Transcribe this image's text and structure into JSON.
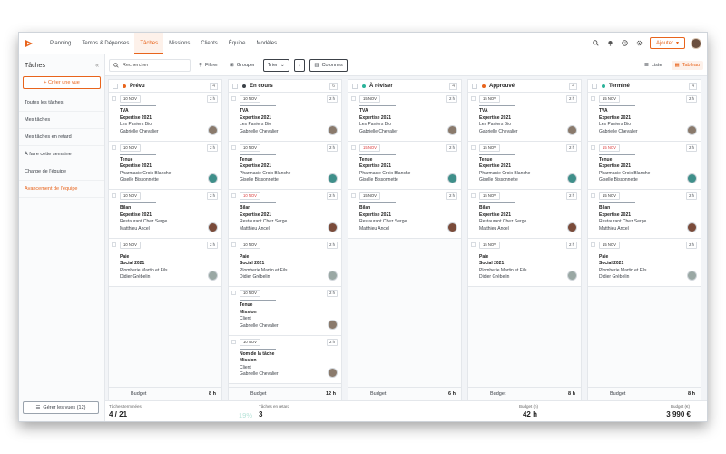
{
  "nav": {
    "items": [
      "Planning",
      "Temps & Dépenses",
      "Tâches",
      "Missions",
      "Clients",
      "Équipe",
      "Modèles"
    ],
    "active_index": 2,
    "add_label": "Ajouter"
  },
  "sidebar": {
    "title": "Tâches",
    "create_label": "+ Créer une vue",
    "items": [
      "Toutes les tâches",
      "Mes tâches",
      "Mes tâches en retard",
      "À faire cette semaine",
      "Charge de l'équipe",
      "Avancement de l'équipe"
    ],
    "active_index": 5,
    "manage_label": "Gérer les vues (12)"
  },
  "toolbar": {
    "search_placeholder": "Rechercher",
    "filter_label": "Filtrer",
    "group_label": "Grouper",
    "sort_label": "Trier",
    "columns_label": "Colonnes",
    "list_label": "Liste",
    "board_label": "Tableau"
  },
  "colors": {
    "accent": "#e8641c",
    "planned": "#e8641c",
    "in_progress": "#3c4148",
    "review": "#2bb39a",
    "approved": "#e8641c",
    "done": "#2bb39a"
  },
  "columns": [
    {
      "title": "Prévu",
      "dot": "#e8641c",
      "count": "4",
      "cards": [
        {
          "date": "10 NOV",
          "late": false,
          "hours": "2 h",
          "t1": "TVA",
          "t2": "Expertise 2021",
          "client": "Les Paniers Bio",
          "person": "Gabrielle Chevalier",
          "av": "#8a7a6c"
        },
        {
          "date": "10 NOV",
          "late": false,
          "hours": "2 h",
          "t1": "Tenue",
          "t2": "Expertise 2021",
          "client": "Pharmacie Croix Blanche",
          "person": "Giselle Bissonnette",
          "av": "#3f8f8a"
        },
        {
          "date": "10 NOV",
          "late": false,
          "hours": "2 h",
          "t1": "Bilan",
          "t2": "Expertise 2021",
          "client": "Restaurant Chez Serge",
          "person": "Matthieu Ancel",
          "av": "#7a4b3a"
        },
        {
          "date": "10 NOV",
          "late": false,
          "hours": "2 h",
          "t1": "Paie",
          "t2": "Social 2021",
          "client": "Plomberie Martin et Fils",
          "person": "Didier Grébelin",
          "av": "#9aa8a4"
        }
      ],
      "budget_label": "Budget",
      "budget": "8 h"
    },
    {
      "title": "En cours",
      "dot": "#3c4148",
      "count": "6",
      "cards": [
        {
          "date": "10 NOV",
          "late": false,
          "hours": "2 h",
          "t1": "TVA",
          "t2": "Expertise 2021",
          "client": "Les Paniers Bio",
          "person": "Gabrielle Chevalier",
          "av": "#8a7a6c"
        },
        {
          "date": "10 NOV",
          "late": false,
          "hours": "2 h",
          "t1": "Tenue",
          "t2": "Expertise 2021",
          "client": "Pharmacie Croix Blanche",
          "person": "Giselle Bissonnette",
          "av": "#3f8f8a"
        },
        {
          "date": "10 NOV",
          "late": true,
          "hours": "2 h",
          "t1": "Bilan",
          "t2": "Expertise 2021",
          "client": "Restaurant Chez Serge",
          "person": "Matthieu Ancel",
          "av": "#7a4b3a"
        },
        {
          "date": "10 NOV",
          "late": false,
          "hours": "2 h",
          "t1": "Paie",
          "t2": "Social 2021",
          "client": "Plomberie Martin et Fils",
          "person": "Didier Grébelin",
          "av": "#9aa8a4"
        },
        {
          "date": "10 NOV",
          "late": false,
          "hours": "2 h",
          "t1": "Tenue",
          "t2": "Mission",
          "client": "Client",
          "person": "Gabrielle Chevalier",
          "av": "#8a7a6c"
        },
        {
          "date": "10 NOV",
          "late": false,
          "hours": "2 h",
          "t1": "Nom de la tâche",
          "t2": "Mission",
          "client": "Client",
          "person": "Gabrielle Chevalier",
          "av": "#8a7a6c"
        }
      ],
      "budget_label": "Budget",
      "budget": "12 h"
    },
    {
      "title": "À réviser",
      "dot": "#2bb39a",
      "count": "4",
      "cards": [
        {
          "date": "15 NOV",
          "late": false,
          "hours": "2 h",
          "t1": "TVA",
          "t2": "Expertise 2021",
          "client": "Les Paniers Bio",
          "person": "Gabrielle Chevalier",
          "av": "#8a7a6c"
        },
        {
          "date": "15 NOV",
          "late": true,
          "hours": "2 h",
          "t1": "Tenue",
          "t2": "Expertise 2021",
          "client": "Pharmacie Croix Blanche",
          "person": "Giselle Bissonnette",
          "av": "#3f8f8a"
        },
        {
          "date": "15 NOV",
          "late": false,
          "hours": "2 h",
          "t1": "Bilan",
          "t2": "Expertise 2021",
          "client": "Restaurant Chez Serge",
          "person": "Matthieu Ancel",
          "av": "#7a4b3a"
        }
      ],
      "budget_label": "Budget",
      "budget": "6 h"
    },
    {
      "title": "Approuvé",
      "dot": "#e8641c",
      "count": "4",
      "cards": [
        {
          "date": "15 NOV",
          "late": false,
          "hours": "2 h",
          "t1": "TVA",
          "t2": "Expertise 2021",
          "client": "Les Paniers Bio",
          "person": "Gabrielle Chevalier",
          "av": "#8a7a6c"
        },
        {
          "date": "15 NOV",
          "late": false,
          "hours": "2 h",
          "t1": "Tenue",
          "t2": "Expertise 2021",
          "client": "Pharmacie Croix Blanche",
          "person": "Giselle Bissonnette",
          "av": "#3f8f8a"
        },
        {
          "date": "15 NOV",
          "late": false,
          "hours": "2 h",
          "t1": "Bilan",
          "t2": "Expertise 2021",
          "client": "Restaurant Chez Serge",
          "person": "Matthieu Ancel",
          "av": "#7a4b3a"
        },
        {
          "date": "15 NOV",
          "late": false,
          "hours": "2 h",
          "t1": "Paie",
          "t2": "Social 2021",
          "client": "Plomberie Martin et Fils",
          "person": "Didier Grébelin",
          "av": "#9aa8a4"
        }
      ],
      "budget_label": "Budget",
      "budget": "8 h"
    },
    {
      "title": "Terminé",
      "dot": "#2bb39a",
      "count": "4",
      "cards": [
        {
          "date": "15 NOV",
          "late": false,
          "hours": "2 h",
          "t1": "TVA",
          "t2": "Expertise 2021",
          "client": "Les Paniers Bio",
          "person": "Gabrielle Chevalier",
          "av": "#8a7a6c"
        },
        {
          "date": "15 NOV",
          "late": true,
          "hours": "2 h",
          "t1": "Tenue",
          "t2": "Expertise 2021",
          "client": "Pharmacie Croix Blanche",
          "person": "Giselle Bissonnette",
          "av": "#3f8f8a"
        },
        {
          "date": "15 NOV",
          "late": false,
          "hours": "2 h",
          "t1": "Bilan",
          "t2": "Expertise 2021",
          "client": "Restaurant Chez Serge",
          "person": "Matthieu Ancel",
          "av": "#7a4b3a"
        },
        {
          "date": "15 NOV",
          "late": false,
          "hours": "2 h",
          "t1": "Paie",
          "t2": "Social 2021",
          "client": "Plomberie Martin et Fils",
          "person": "Didier Grébelin",
          "av": "#9aa8a4"
        }
      ],
      "budget_label": "Budget",
      "budget": "8 h"
    }
  ],
  "stats": {
    "done_label": "Tâches terminées",
    "done_value": "4 / 21",
    "done_pct": "19%",
    "late_label": "Tâches en retard",
    "late_value": "3",
    "budget_h_label": "Budget (h)",
    "budget_h_value": "42 h",
    "budget_eur_label": "Budget (€)",
    "budget_eur_value": "3 990 €"
  }
}
